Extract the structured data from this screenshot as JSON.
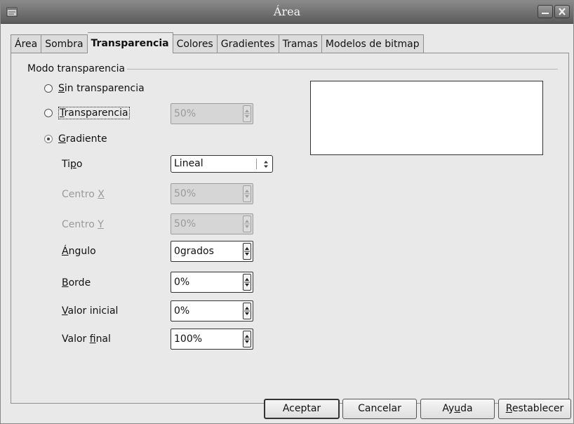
{
  "window": {
    "title": "Área"
  },
  "tabs": [
    {
      "label": "Área",
      "active": false
    },
    {
      "label": "Sombra",
      "active": false
    },
    {
      "label": "Transparencia",
      "active": true
    },
    {
      "label": "Colores",
      "active": false
    },
    {
      "label": "Gradientes",
      "active": false
    },
    {
      "label": "Tramas",
      "active": false
    },
    {
      "label": "Modelos de bitmap",
      "active": false
    }
  ],
  "group": {
    "label": "Modo transparencia"
  },
  "radios": {
    "none": {
      "pre": "",
      "accel": "S",
      "post": "in transparencia",
      "checked": false
    },
    "transparency": {
      "pre": "",
      "accel": "T",
      "post": "ransparencia",
      "checked": false
    },
    "gradient": {
      "pre": "",
      "accel": "G",
      "post": "radiente",
      "checked": true
    }
  },
  "transparency_value": "50%",
  "fields": {
    "tipo": {
      "pre": "Ti",
      "accel": "p",
      "post": "o",
      "value": "Lineal"
    },
    "centro_x": {
      "pre": "Centro ",
      "accel": "X",
      "post": "",
      "value": "50%"
    },
    "centro_y": {
      "pre": "Centro ",
      "accel": "Y",
      "post": "",
      "value": "50%"
    },
    "angulo": {
      "pre": "",
      "accel": "Á",
      "post": "ngulo",
      "value": "0grados"
    },
    "borde": {
      "pre": "",
      "accel": "B",
      "post": "orde",
      "value": "0%"
    },
    "valor_inicial": {
      "pre": "",
      "accel": "V",
      "post": "alor inicial",
      "value": "0%"
    },
    "valor_final": {
      "pre": "Valor ",
      "accel": "f",
      "post": "inal",
      "value": "100%"
    }
  },
  "buttons": {
    "accept": "Aceptar",
    "cancel": {
      "label": "Cancelar"
    },
    "help": {
      "pre": "Ay",
      "accel": "u",
      "post": "da"
    },
    "reset": {
      "pre": "",
      "accel": "R",
      "post": "establecer"
    }
  },
  "icons": {
    "app": "window-menu-icon",
    "minimize": "minimize-icon",
    "close": "close-icon"
  },
  "colors": {
    "titlebar": "#5b5b5b",
    "dialog_bg": "#e9e9e9"
  }
}
